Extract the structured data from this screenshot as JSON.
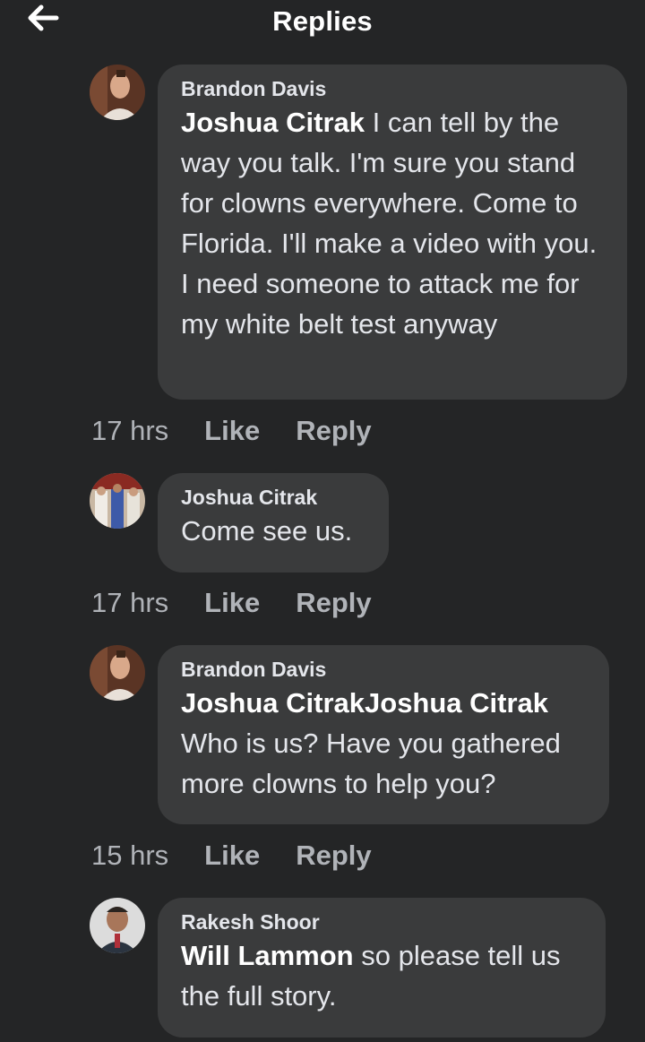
{
  "header": {
    "title": "Replies",
    "back_icon": "arrow-left-icon"
  },
  "comments": [
    {
      "author": "Brandon Davis",
      "mention": "Joshua Citrak",
      "text": " I can tell by the way you talk. I'm sure you stand for clowns everywhere. Come to Florida. I'll make a video with you. I need someone to attack me for my white belt test anyway",
      "time": "17 hrs",
      "like": "Like",
      "reply": "Reply"
    },
    {
      "author": "Joshua Citrak",
      "mention": "",
      "text": "Come see us.",
      "time": "17 hrs",
      "like": "Like",
      "reply": "Reply"
    },
    {
      "author": "Brandon Davis",
      "mention": "Joshua CitrakJoshua Citrak",
      "text": "Who is us? Have you gathered more clowns to help you?",
      "time": "15 hrs",
      "like": "Like",
      "reply": "Reply"
    },
    {
      "author": "Rakesh Shoor",
      "mention": "Will Lammon",
      "text": " so please tell us the full story.",
      "time": "",
      "like": "",
      "reply": ""
    }
  ],
  "colors": {
    "background": "#242526",
    "bubble": "#3a3b3c",
    "text": "#e4e6eb",
    "meta": "#b0b3b8"
  }
}
